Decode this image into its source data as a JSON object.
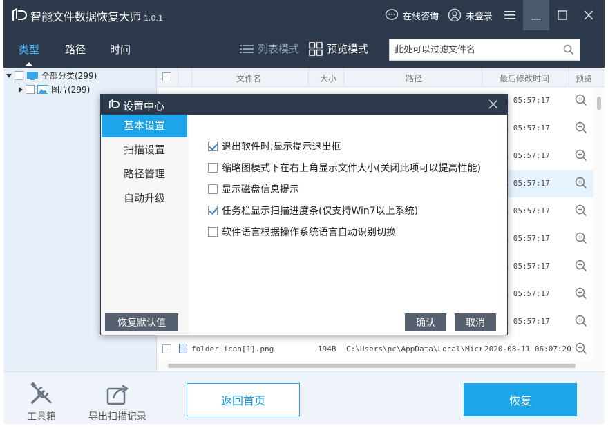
{
  "window": {
    "title": "智能文件数据恢复大师",
    "version": "1.0.1",
    "online_consult": "在线咨询",
    "login": "未登录"
  },
  "nav": {
    "tabs": [
      "类型",
      "路径",
      "时间"
    ],
    "active_tab": "类型",
    "list_mode": "列表模式",
    "preview_mode": "预览模式",
    "filter_placeholder": "此处可以过滤文件名"
  },
  "tree": {
    "root_label": "全部分类(299)",
    "child_label": "图片(299)"
  },
  "list": {
    "columns": [
      "文件名",
      "大小",
      "路径",
      "最后修改时间",
      "预览"
    ],
    "rows": [
      {
        "date": "08-11 05:57:17"
      },
      {
        "date": "08-11 05:57:17"
      },
      {
        "date": "08-11 05:57:17"
      },
      {
        "date": "08-11 05:57:17"
      },
      {
        "date": "08-11 05:57:17"
      },
      {
        "date": "08-11 05:57:17"
      },
      {
        "date": "08-11 05:57:17"
      },
      {
        "date": "08-11 05:57:17"
      },
      {
        "date": "08-11 05:57:17"
      }
    ],
    "visible_row": {
      "name": "folder_icon[1].png",
      "size": "194B",
      "path": "C:\\Users\\pc\\AppData\\Local\\Micros",
      "date": "2020-08-11 06:07:20"
    }
  },
  "bottom": {
    "toolbox": "工具箱",
    "export": "导出扫描记录",
    "home": "返回首页",
    "recover": "恢复"
  },
  "dialog": {
    "title": "设置中心",
    "sidebar": [
      "基本设置",
      "扫描设置",
      "路径管理",
      "自动升级"
    ],
    "active": "基本设置",
    "options": [
      {
        "label": "退出软件时,显示提示退出框",
        "checked": true
      },
      {
        "label": "缩略图模式下在右上角显示文件大小(关闭此项可以提高性能)",
        "checked": false
      },
      {
        "label": "显示磁盘信息提示",
        "checked": false
      },
      {
        "label": "任务栏显示扫描进度条(仅支持Win7以上系统)",
        "checked": true
      },
      {
        "label": "软件语言根据操作系统语言自动识别切换",
        "checked": false
      }
    ],
    "reset_btn": "恢复默认值",
    "ok_btn": "确认",
    "cancel_btn": "取消"
  },
  "colors": {
    "titlebar": "#2d3a4c",
    "accent": "#1ea4ea",
    "tab_active": "#3ab4ff"
  }
}
